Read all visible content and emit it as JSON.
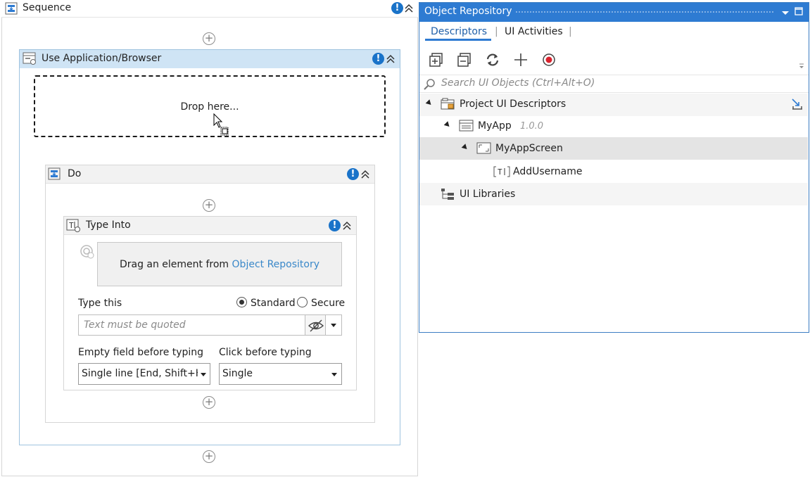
{
  "designer": {
    "sequence": {
      "title": "Sequence"
    },
    "use_app": {
      "title": "Use Application/Browser",
      "drop_text": "Drop here..."
    },
    "do": {
      "title": "Do"
    },
    "type_into": {
      "title": "Type Into",
      "target_prefix": "Drag an element from ",
      "target_link": "Object Repository",
      "type_this_label": "Type this",
      "radio_standard": "Standard",
      "radio_secure": "Secure",
      "text_placeholder": "Text must be quoted",
      "empty_field_label": "Empty field before typing",
      "empty_field_value": "Single line [End, Shift+H",
      "click_before_label": "Click before typing",
      "click_before_value": "Single"
    }
  },
  "object_repository": {
    "title": "Object Repository",
    "tabs": [
      {
        "label": "Descriptors",
        "active": true
      },
      {
        "label": "UI Activities",
        "active": false
      }
    ],
    "search_placeholder": "Search UI Objects (Ctrl+Alt+O)",
    "tree": {
      "project": "Project UI Descriptors",
      "app": "MyApp",
      "app_version": "1.0.0",
      "screen": "MyAppScreen",
      "element": "AddUsername",
      "libraries": "UI Libraries"
    }
  },
  "colors": {
    "accent": "#2e7bd2",
    "info": "#1a73c9",
    "link": "#3a88c9",
    "use_app_header": "#cfe4f5",
    "record": "#d9232e"
  }
}
